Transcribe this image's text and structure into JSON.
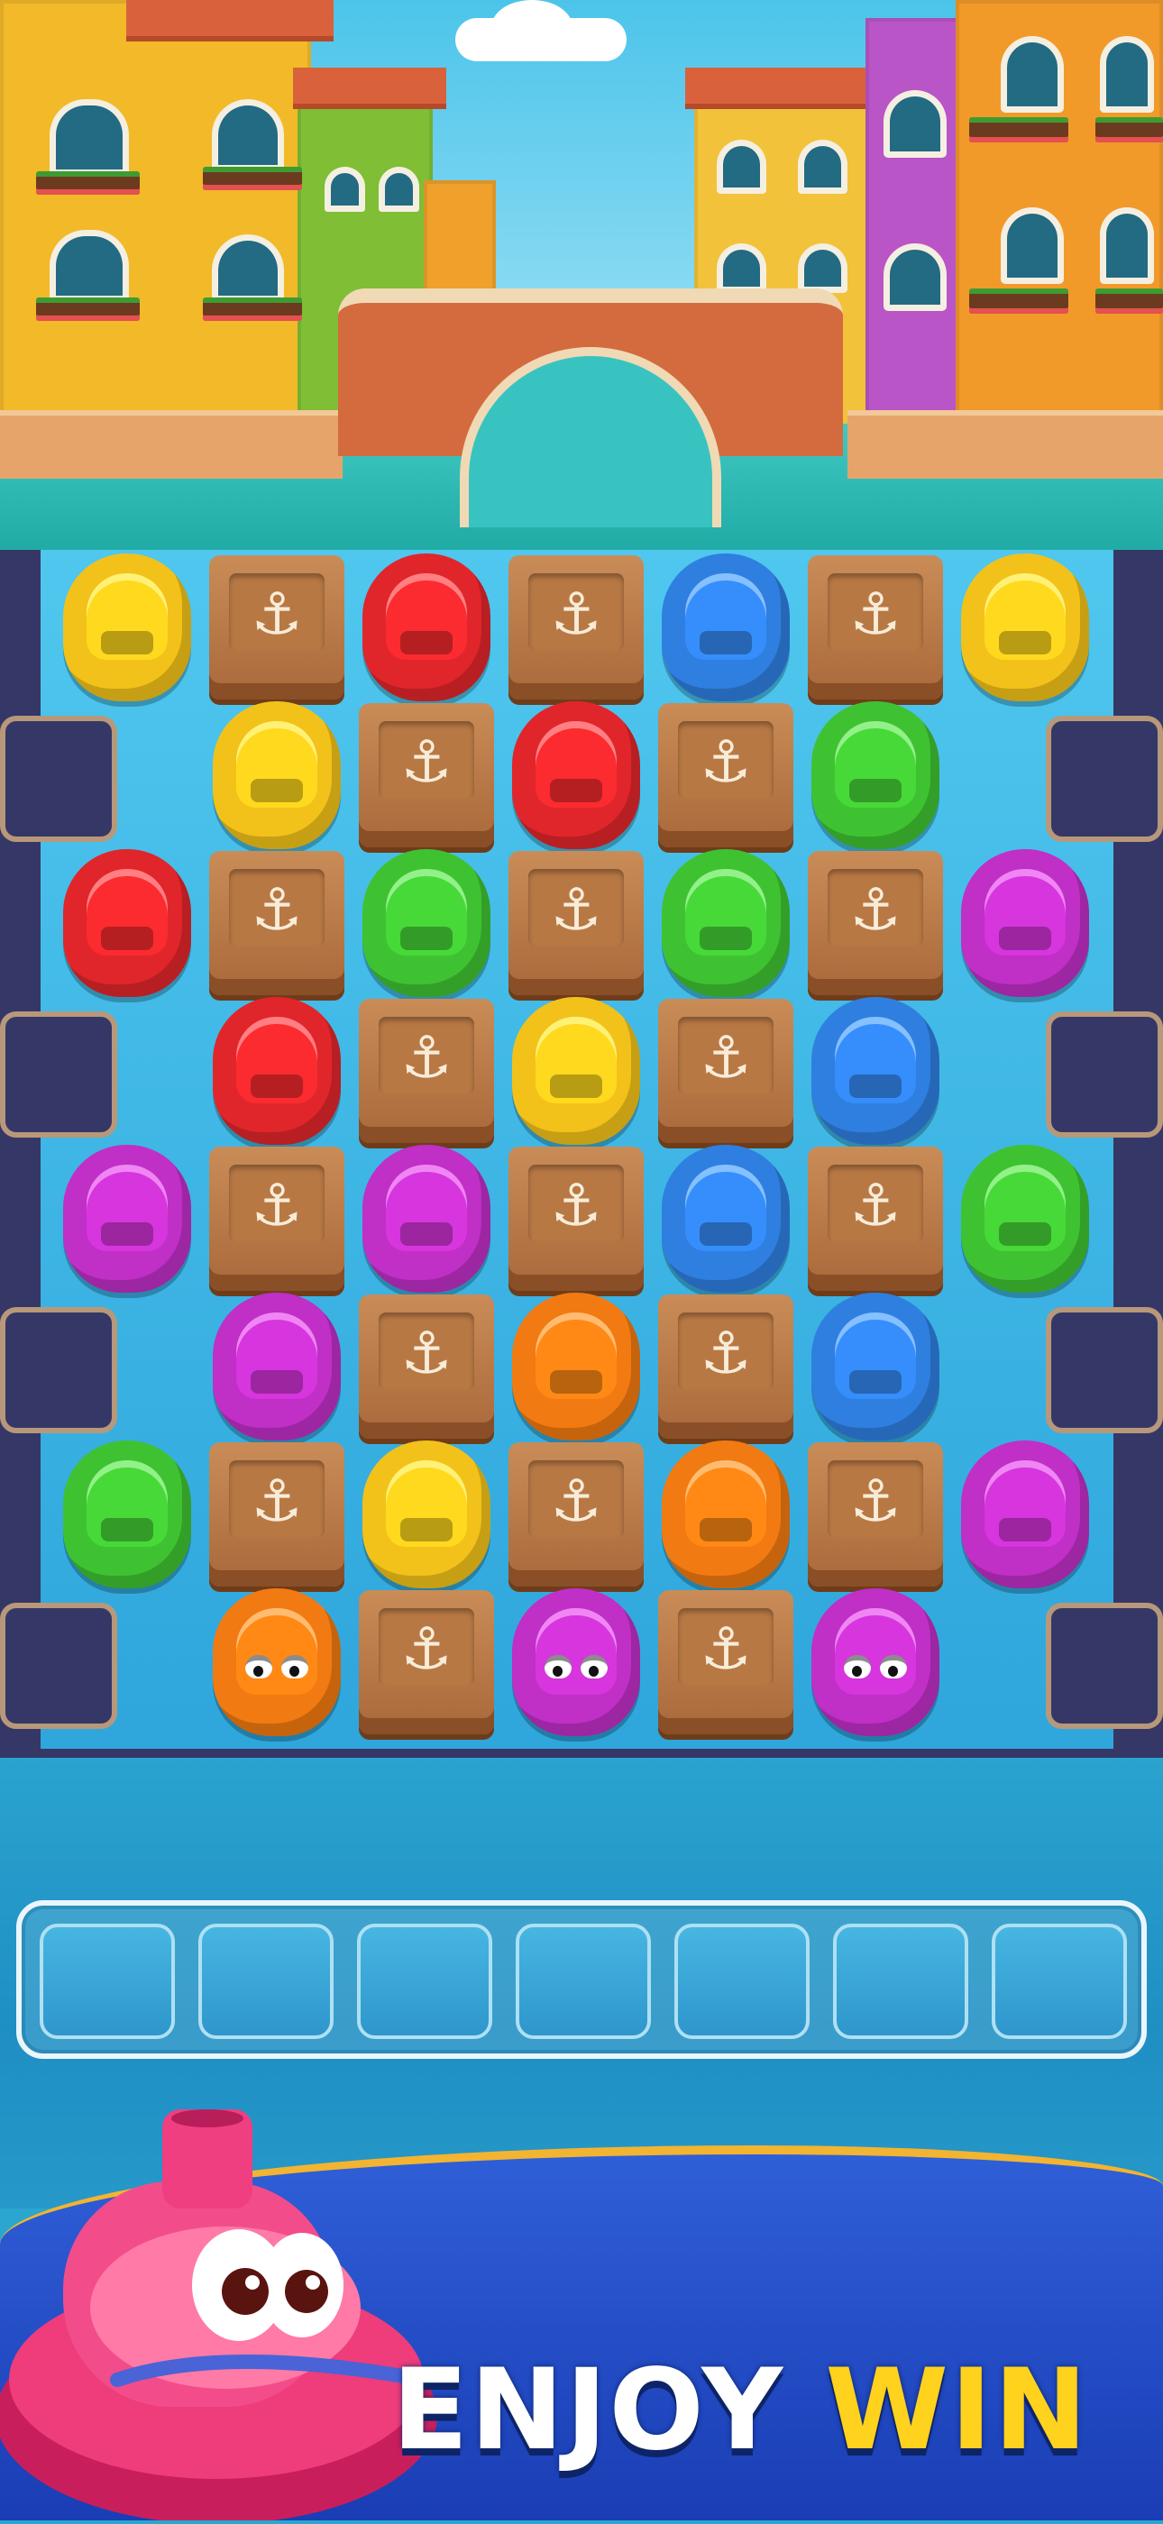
{
  "banner": {
    "title_main": "ENJOY",
    "title_highlight": "WIN"
  },
  "colors": {
    "yellow": "#f2c21a",
    "red": "#e0262b",
    "blue": "#2f7fe0",
    "green": "#3fc232",
    "magenta": "#c02fc6",
    "orange": "#f27a12",
    "crate": "#b8773f",
    "title_highlight": "#ffd21d"
  },
  "board": {
    "rows": [
      [
        "yellow",
        "crate",
        "red",
        "crate",
        "blue",
        "crate",
        "yellow"
      ],
      [
        "yellow",
        "crate",
        "red",
        "crate",
        "green"
      ],
      [
        "red",
        "crate",
        "green",
        "crate",
        "green",
        "crate",
        "magenta"
      ],
      [
        "red",
        "crate",
        "yellow",
        "crate",
        "blue"
      ],
      [
        "magenta",
        "crate",
        "magenta",
        "crate",
        "blue",
        "crate",
        "green"
      ],
      [
        "magenta",
        "crate",
        "orange",
        "crate",
        "blue"
      ],
      [
        "green",
        "crate",
        "yellow",
        "crate",
        "orange",
        "crate",
        "magenta"
      ],
      [
        "orange-face",
        "crate",
        "magenta-face",
        "crate",
        "magenta-face"
      ]
    ],
    "crate_icon": "anchor-icon",
    "crate_symbol": "⚓"
  },
  "tray": {
    "slot_count": 7,
    "slots": [
      "",
      "",
      "",
      "",
      "",
      "",
      ""
    ]
  },
  "mascot": {
    "icon": "pink-boat-mascot-icon",
    "color": "#e8336e"
  }
}
